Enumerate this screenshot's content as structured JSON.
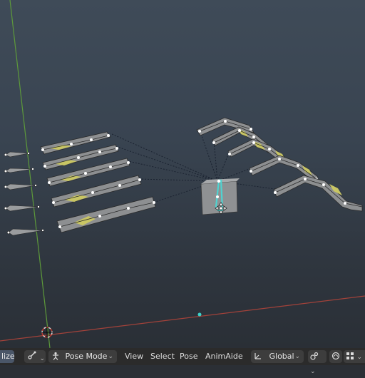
{
  "header": {
    "left_stub_label": "lize",
    "mode_label": "Pose Mode",
    "menu": [
      "View",
      "Select",
      "Pose",
      "AnimAide"
    ],
    "transform_orientation": "Global"
  },
  "icons": {
    "mode_icon": "pose-mode-icon",
    "editor_icon": "armature-icon",
    "orientation_icon": "transform-orientation-icon",
    "snap_icon": "snap-icon",
    "proportional_icon": "proportional-editing-icon",
    "grid_icon": "grid-icon"
  },
  "colors": {
    "x_axis": "#a3423a",
    "y_axis": "#5d9a3a",
    "selected_bone": "#4fd3d0",
    "bone_fill": "#8d8f91",
    "bone_highlight": "#c8c564",
    "viewport_top": "#3f4b58",
    "header_bg": "#2b2b2b"
  }
}
